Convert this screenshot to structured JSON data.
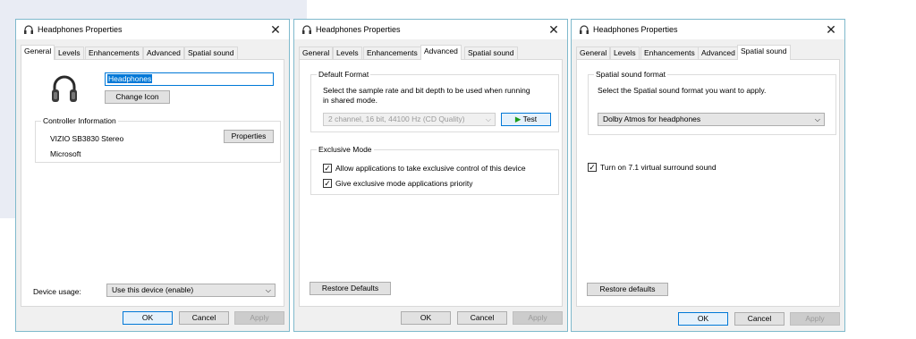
{
  "dialogs": [
    {
      "title": "Headphones Properties",
      "tabs": [
        "General",
        "Levels",
        "Enhancements",
        "Advanced",
        "Spatial sound"
      ],
      "active_tab": "General",
      "device_name": "Headphones",
      "change_icon": "Change Icon",
      "controller_group": "Controller Information",
      "controller_name": "VIZIO SB3830 Stereo",
      "controller_vendor": "Microsoft",
      "properties_button": "Properties",
      "device_usage_label": "Device usage:",
      "device_usage_value": "Use this device (enable)",
      "buttons": {
        "ok": "OK",
        "cancel": "Cancel",
        "apply": "Apply"
      }
    },
    {
      "title": "Headphones Properties",
      "tabs": [
        "General",
        "Levels",
        "Enhancements",
        "Advanced",
        "Spatial sound"
      ],
      "active_tab": "Advanced",
      "default_format_group": "Default Format",
      "default_format_desc1": "Select the sample rate and bit depth to be used when running",
      "default_format_desc2": "in shared mode.",
      "format_value": "2 channel, 16 bit, 44100 Hz (CD Quality)",
      "test_button": "Test",
      "exclusive_group": "Exclusive Mode",
      "exclusive_allow": "Allow applications to take exclusive control of this device",
      "exclusive_priority": "Give exclusive mode applications priority",
      "restore_defaults": "Restore Defaults",
      "buttons": {
        "ok": "OK",
        "cancel": "Cancel",
        "apply": "Apply"
      }
    },
    {
      "title": "Headphones Properties",
      "tabs": [
        "General",
        "Levels",
        "Enhancements",
        "Advanced",
        "Spatial sound"
      ],
      "active_tab": "Spatial sound",
      "spatial_group": "Spatial sound format",
      "spatial_desc": "Select the Spatial sound format you want to apply.",
      "spatial_value": "Dolby Atmos for headphones",
      "surround_label": "Turn on 7.1 virtual surround sound",
      "restore_defaults": "Restore defaults",
      "buttons": {
        "ok": "OK",
        "cancel": "Cancel",
        "apply": "Apply"
      }
    }
  ],
  "icons": {
    "close": "close-icon",
    "dropdown": "chevron-down-icon",
    "test": "play-icon",
    "check": "checkmark-icon",
    "window": "headphones-icon"
  },
  "colors": {
    "accent": "#0078d7",
    "dialog_border": "#7fb9cc",
    "play": "#1a9b1a"
  }
}
